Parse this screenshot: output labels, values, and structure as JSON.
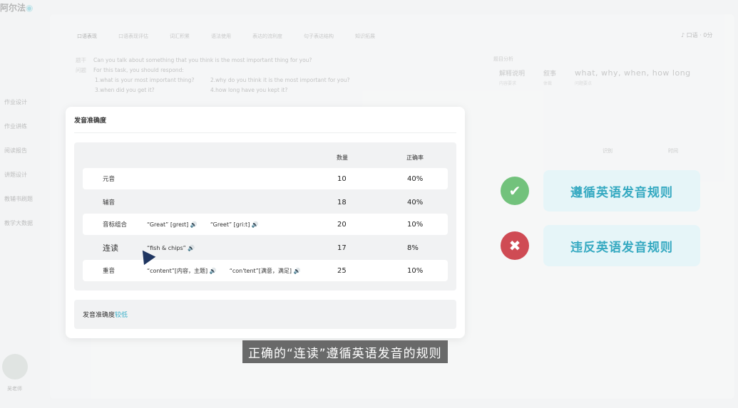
{
  "app": {
    "logo": "阿尔法",
    "logo_mark": "◉"
  },
  "sidebar": {
    "items": [
      "作业设计",
      "作业讲练",
      "阅读报告",
      "讲题设计",
      "教辅书刷题",
      "教学大数据"
    ],
    "user": "吴老师"
  },
  "topnav": {
    "tabs": [
      "口语表现",
      "口语表现评估",
      "词汇积累",
      "语法使用",
      "表达的流利度",
      "句子表达结构",
      "知识拓展"
    ]
  },
  "topright": {
    "score": "♪ 口语 · 0分"
  },
  "question": {
    "topic_label": "题干",
    "topic": "Can you talk about something that you think is the most important thing for you?",
    "req_label": "问题",
    "intro": "For this task, you should respond:",
    "subs": [
      "1.what is your most important thing?",
      "2.why do you think it is the most important for you?",
      "3.when did you get it?",
      "4.how long have you kept it?"
    ]
  },
  "keyinfo": {
    "label": "题目分析",
    "items": [
      {
        "main": "解释说明",
        "sub": "内容要求"
      },
      {
        "main": "叙事",
        "sub": "体裁"
      },
      {
        "main": "what, why, when, how long",
        "sub": "问题要点"
      }
    ]
  },
  "bg_columns": [
    "识别",
    "时间"
  ],
  "rules": {
    "follow": "遵循英语发音规则",
    "violate": "违反英语发音规则"
  },
  "modal": {
    "title": "发音准确度",
    "headers": {
      "count": "数量",
      "rate": "正确率"
    },
    "rows": [
      {
        "name": "元音",
        "examples": [],
        "count": "10",
        "rate": "40%"
      },
      {
        "name": "辅音",
        "examples": [],
        "count": "18",
        "rate": "40%"
      },
      {
        "name": "音标组合",
        "examples": [
          "“Great” [greɪt]",
          "“Greet” [gri:t]"
        ],
        "count": "20",
        "rate": "10%"
      },
      {
        "name": "连读",
        "examples": [
          "“fish & chips”"
        ],
        "count": "17",
        "rate": "8%"
      },
      {
        "name": "重音",
        "examples": [
          "“content”[内容，主题]",
          "“con'tent”[满意，满足]"
        ],
        "count": "25",
        "rate": "10%"
      }
    ],
    "summary_label": "发音准确度",
    "summary_value": "较低"
  },
  "subtitle": "正确的“连读”遵循英语发音的规则",
  "colors": {
    "accent": "#3bb0c9",
    "ok": "#72c27c",
    "bad": "#cf4b54"
  }
}
